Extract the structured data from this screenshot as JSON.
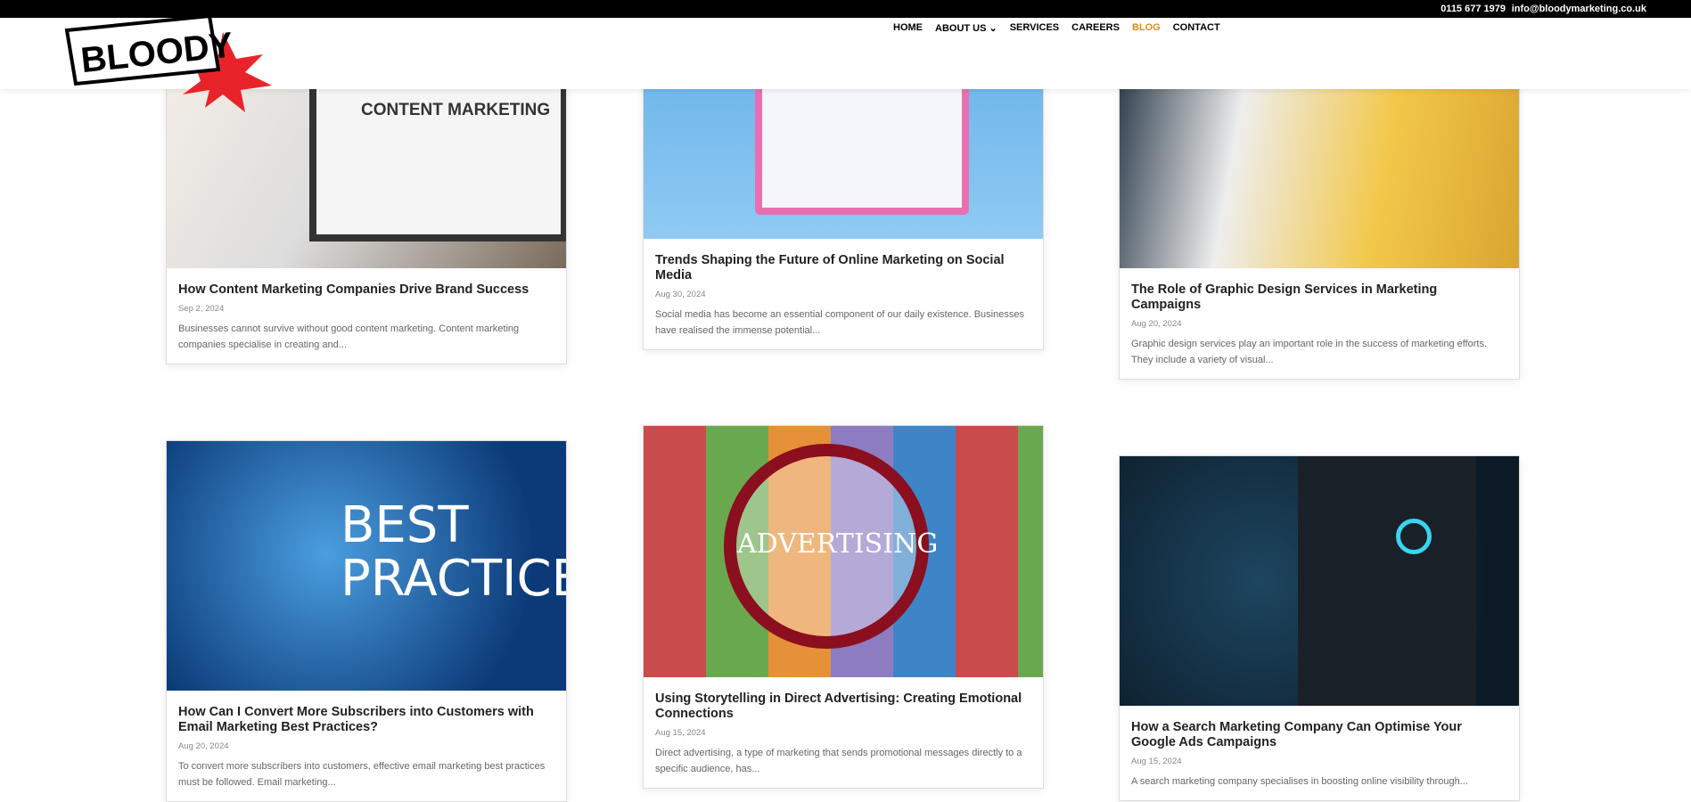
{
  "topbar": {
    "phone": "0115 677 1979",
    "email": "info@bloodymarketing.co.uk"
  },
  "logo": {
    "text": "BLOODY"
  },
  "nav": [
    {
      "label": "HOME"
    },
    {
      "label": "ABOUT US ⌄"
    },
    {
      "label": "SERVICES"
    },
    {
      "label": "CAREERS"
    },
    {
      "label": "BLOG"
    },
    {
      "label": "CONTACT"
    }
  ],
  "posts": [
    {
      "title": "How Content Marketing Companies Drive Brand Success",
      "date": "Sep 2, 2024",
      "excerpt": "Businesses cannot survive without good content marketing. Content marketing companies specialise in creating and...",
      "image_text": "CONTENT MARKETING"
    },
    {
      "title": "Trends Shaping the Future of Online Marketing on Social Media",
      "date": "Aug 30, 2024",
      "excerpt": "Social media has become an essential component of our daily existence. Businesses have realised the immense potential..."
    },
    {
      "title": "The Role of Graphic Design Services in Marketing Campaigns",
      "date": "Aug 20, 2024",
      "excerpt": "Graphic design services play an important role in the success of marketing efforts. They include a variety of visual..."
    },
    {
      "title": "How Can I Convert More Subscribers into Customers with Email Marketing Best Practices?",
      "date": "Aug 20, 2024",
      "excerpt": "To convert more subscribers into customers, effective email marketing best practices must be followed. Email marketing...",
      "image_text": "BEST PRACTICE"
    },
    {
      "title": "Using Storytelling in Direct Advertising: Creating Emotional Connections",
      "date": "Aug 15, 2024",
      "excerpt": "Direct advertising, a type of marketing that sends promotional messages directly to a specific audience, has...",
      "image_text": "ADVERTISING"
    },
    {
      "title": "How a Search Marketing Company Can Optimise Your Google Ads Campaigns",
      "date": "Aug 15, 2024",
      "excerpt": "A search marketing company specialises in boosting online visibility through..."
    }
  ]
}
